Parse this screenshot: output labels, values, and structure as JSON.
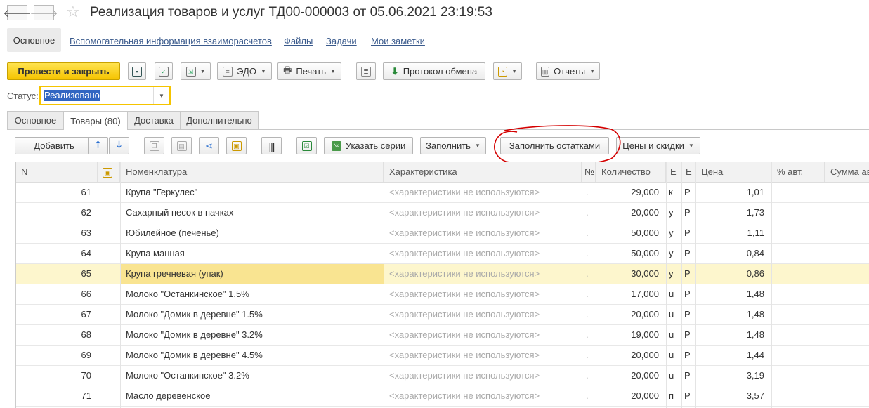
{
  "header": {
    "back_icon": "arrow-left-icon",
    "forward_icon": "arrow-right-icon",
    "favorite_icon": "star-icon",
    "title": "Реализация товаров и услуг ТД00-000003 от 05.06.2021 23:19:53"
  },
  "nav": {
    "items": [
      "Основное",
      "Вспомогательная информация взаиморасчетов",
      "Файлы",
      "Задачи",
      "Мои заметки"
    ]
  },
  "toolbar": {
    "post_close": "Провести и закрыть",
    "edo": "ЭДО",
    "print": "Печать",
    "exchange_log": "Протокол обмена",
    "reports": "Отчеты"
  },
  "status": {
    "label": "Статус:",
    "value": "Реализовано"
  },
  "tabs": [
    "Основное",
    "Товары (80)",
    "Доставка",
    "Дополнительно"
  ],
  "table_toolbar": {
    "add": "Добавить",
    "series": "Указать серии",
    "fill": "Заполнить",
    "fill_remains": "Заполнить остатками",
    "prices": "Цены и скидки"
  },
  "colors": {
    "accent_yellow": "#f5c400",
    "selected_row": "#fdf6cd",
    "link": "#3a5a8c",
    "annotation": "#d40000"
  },
  "grid": {
    "columns": [
      "N",
      "",
      "Номенклатура",
      "Характеристика",
      "№",
      "Количество",
      "Е",
      "Е",
      "Цена",
      "% авт.",
      "Сумма ав"
    ],
    "rows": [
      {
        "n": "61",
        "name": "Крупа \"Геркулес\"",
        "char": "<характеристики не используются>",
        "qty": "29,000",
        "unit": "к",
        "u2": "Р",
        "price": "1,01"
      },
      {
        "n": "62",
        "name": "Сахарный песок в пачках",
        "char": "<характеристики не используются>",
        "qty": "20,000",
        "unit": "у",
        "u2": "Р",
        "price": "1,73"
      },
      {
        "n": "63",
        "name": "Юбилейное (печенье)",
        "char": "<характеристики не используются>",
        "qty": "50,000",
        "unit": "у",
        "u2": "Р",
        "price": "1,11"
      },
      {
        "n": "64",
        "name": "Крупа манная",
        "char": "<характеристики не используются>",
        "qty": "50,000",
        "unit": "у",
        "u2": "Р",
        "price": "0,84"
      },
      {
        "n": "65",
        "name": "Крупа гречневая (упак)",
        "char": "<характеристики не используются>",
        "qty": "30,000",
        "unit": "у",
        "u2": "Р",
        "price": "0,86"
      },
      {
        "n": "66",
        "name": "Молоко \"Останкинское\" 1.5%",
        "char": "<характеристики не используются>",
        "qty": "17,000",
        "unit": "u",
        "u2": "Р",
        "price": "1,48"
      },
      {
        "n": "67",
        "name": "Молоко \"Домик в деревне\" 1.5%",
        "char": "<характеристики не используются>",
        "qty": "20,000",
        "unit": "u",
        "u2": "Р",
        "price": "1,48"
      },
      {
        "n": "68",
        "name": "Молоко \"Домик в деревне\" 3.2%",
        "char": "<характеристики не используются>",
        "qty": "19,000",
        "unit": "u",
        "u2": "Р",
        "price": "1,48"
      },
      {
        "n": "69",
        "name": "Молоко \"Домик в деревне\" 4.5%",
        "char": "<характеристики не используются>",
        "qty": "20,000",
        "unit": "u",
        "u2": "Р",
        "price": "1,44"
      },
      {
        "n": "70",
        "name": "Молоко \"Останкинское\" 3.2%",
        "char": "<характеристики не используются>",
        "qty": "20,000",
        "unit": "u",
        "u2": "Р",
        "price": "3,19"
      },
      {
        "n": "71",
        "name": "Масло деревенское",
        "char": "<характеристики не используются>",
        "qty": "20,000",
        "unit": "п",
        "u2": "Р",
        "price": "3,57"
      }
    ]
  }
}
